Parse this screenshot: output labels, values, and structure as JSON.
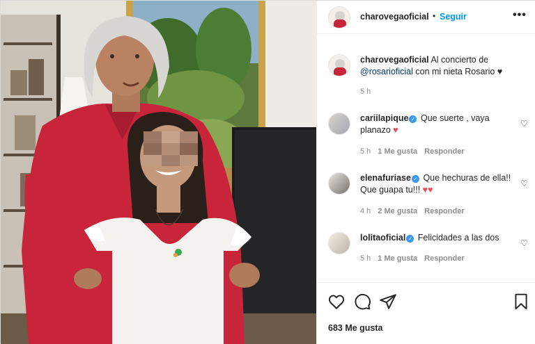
{
  "post": {
    "author": "charovegaoficial",
    "follow_label": "Seguir",
    "dot": "•",
    "more_label": "•••",
    "caption_user": "charovegaoficial",
    "caption_text_1": "Al concierto de",
    "caption_mention": "@rosarioficial",
    "caption_text_2": "con mi nieta Rosario",
    "caption_heart": "♥",
    "caption_time": "5 h"
  },
  "comments": [
    {
      "user": "cariilapique",
      "verified": "✓",
      "text": "Que suerte , vaya planazo",
      "hearts": "♥",
      "time": "5 h",
      "likes": "1 Me gusta",
      "reply": "Responder"
    },
    {
      "user": "elenafuriase",
      "verified": "✓",
      "text": "Que hechuras de ella!! Que guapa tu!!!",
      "hearts": "♥♥",
      "time": "4 h",
      "likes": "2 Me gusta",
      "reply": "Responder"
    },
    {
      "user": "lolitaoficial",
      "verified": "✓",
      "text": "Felicidades a las dos",
      "hearts": "",
      "time": "5 h",
      "likes": "1 Me gusta",
      "reply": "Responder"
    }
  ],
  "actions": {
    "like_icon": "heart-outline-icon",
    "comment_icon": "comment-icon",
    "share_icon": "share-icon",
    "save_icon": "bookmark-icon",
    "likes_count": "683 Me gusta"
  },
  "colors": {
    "link_blue": "#0095f6",
    "mention": "#00376b",
    "verified": "#3897f0",
    "heart_red": "#ed4956",
    "muted": "#8e8e8e"
  }
}
